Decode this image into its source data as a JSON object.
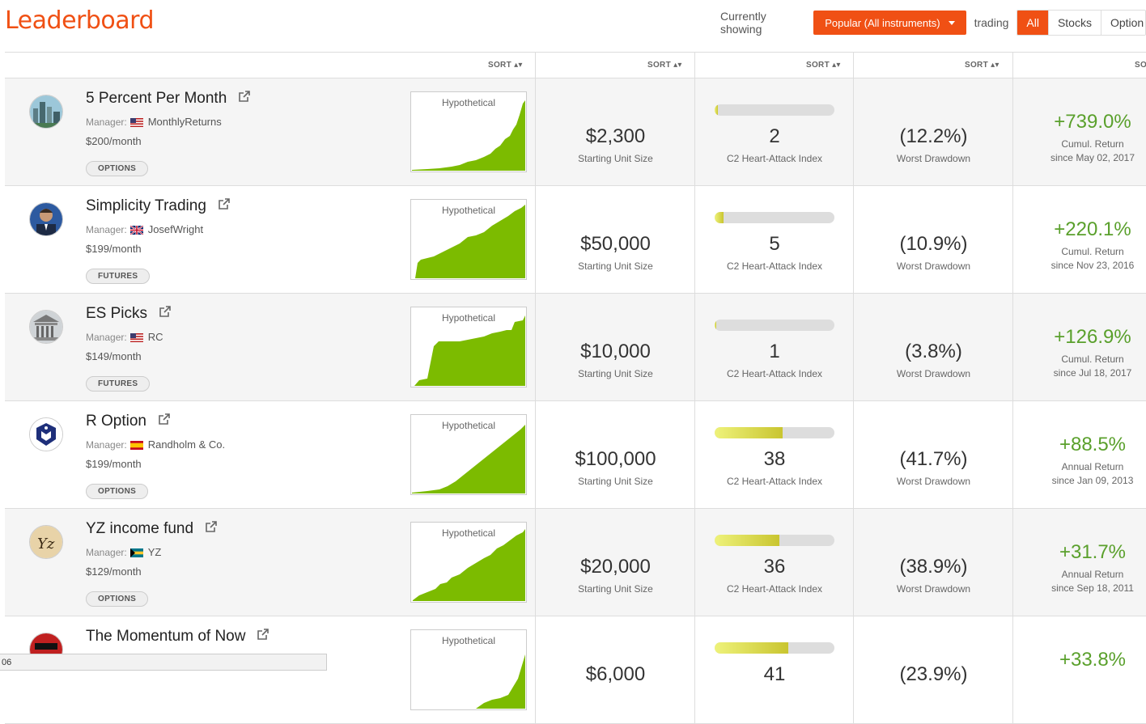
{
  "page_title": "Leaderboard",
  "controls": {
    "currently_showing_label": "Currently showing",
    "dropdown_value": "Popular (All instruments)",
    "trading_label": "trading",
    "tabs": [
      "All",
      "Stocks",
      "Option"
    ],
    "active_tab": "All"
  },
  "sort_label": "SORT",
  "accent_color": "#f05014",
  "positive_color": "#5aa02c",
  "rows": [
    {
      "name": "5 Percent Per Month",
      "manager_label": "Manager:",
      "manager": "MonthlyReturns",
      "flag": "us",
      "price": "$200/month",
      "tag": "OPTIONS",
      "chart_label": "Hypothetical",
      "unit_size": "$2,300",
      "unit_size_label": "Starting Unit Size",
      "heart_attack_index": "2",
      "heart_attack_label": "C2 Heart-Attack Index",
      "drawdown": "(12.2%)",
      "drawdown_label": "Worst Drawdown",
      "return_value": "+739.0%",
      "return_label": "Cumul. Return",
      "return_since": "since May 02, 2017",
      "avatar": "city-icon"
    },
    {
      "name": "Simplicity Trading",
      "manager_label": "Manager:",
      "manager": "JosefWright",
      "flag": "uk",
      "price": "$199/month",
      "tag": "FUTURES",
      "chart_label": "Hypothetical",
      "unit_size": "$50,000",
      "unit_size_label": "Starting Unit Size",
      "heart_attack_index": "5",
      "heart_attack_label": "C2 Heart-Attack Index",
      "drawdown": "(10.9%)",
      "drawdown_label": "Worst Drawdown",
      "return_value": "+220.1%",
      "return_label": "Cumul. Return",
      "return_since": "since Nov 23, 2016",
      "avatar": "person-icon"
    },
    {
      "name": "ES Picks",
      "manager_label": "Manager:",
      "manager": "RC",
      "flag": "us",
      "price": "$149/month",
      "tag": "FUTURES",
      "chart_label": "Hypothetical",
      "unit_size": "$10,000",
      "unit_size_label": "Starting Unit Size",
      "heart_attack_index": "1",
      "heart_attack_label": "C2 Heart-Attack Index",
      "drawdown": "(3.8%)",
      "drawdown_label": "Worst Drawdown",
      "return_value": "+126.9%",
      "return_label": "Cumul. Return",
      "return_since": "since Jul 18, 2017",
      "avatar": "building-icon"
    },
    {
      "name": "R Option",
      "manager_label": "Manager:",
      "manager": "Randholm & Co.",
      "flag": "es",
      "price": "$199/month",
      "tag": "OPTIONS",
      "chart_label": "Hypothetical",
      "unit_size": "$100,000",
      "unit_size_label": "Starting Unit Size",
      "heart_attack_index": "38",
      "heart_attack_label": "C2 Heart-Attack Index",
      "drawdown": "(41.7%)",
      "drawdown_label": "Worst Drawdown",
      "return_value": "+88.5%",
      "return_label": "Annual Return",
      "return_since": "since Jan 09, 2013",
      "avatar": "shield-logo-icon"
    },
    {
      "name": "YZ income fund",
      "manager_label": "Manager:",
      "manager": "YZ",
      "flag": "bs",
      "price": "$129/month",
      "tag": "OPTIONS",
      "chart_label": "Hypothetical",
      "unit_size": "$20,000",
      "unit_size_label": "Starting Unit Size",
      "heart_attack_index": "36",
      "heart_attack_label": "C2 Heart-Attack Index",
      "drawdown": "(38.9%)",
      "drawdown_label": "Worst Drawdown",
      "return_value": "+31.7%",
      "return_label": "Annual Return",
      "return_since": "since Sep 18, 2011",
      "avatar": "yz-logo-icon"
    },
    {
      "name": "The Momentum of Now",
      "chart_label": "Hypothetical",
      "unit_size": "$6,000",
      "heart_attack_index": "41",
      "drawdown": "(23.9%)",
      "return_value": "+33.8%",
      "avatar": "book-cover-icon"
    }
  ],
  "status_bar": "06"
}
